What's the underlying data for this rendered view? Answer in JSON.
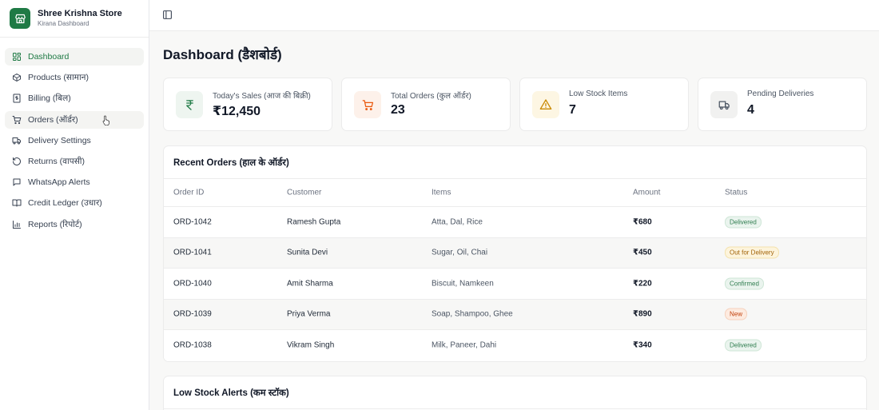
{
  "brand": {
    "name": "Shree Krishna Store",
    "subtitle": "Kirana Dashboard"
  },
  "sidebar": {
    "items": [
      {
        "label": "Dashboard",
        "icon": "grid-icon"
      },
      {
        "label": "Products (सामान)",
        "icon": "box-icon"
      },
      {
        "label": "Billing (बिल)",
        "icon": "receipt-icon"
      },
      {
        "label": "Orders (ऑर्डर)",
        "icon": "cart-icon"
      },
      {
        "label": "Delivery Settings",
        "icon": "truck-icon"
      },
      {
        "label": "Returns (वापसी)",
        "icon": "rotate-ccw-icon"
      },
      {
        "label": "WhatsApp Alerts",
        "icon": "message-icon"
      },
      {
        "label": "Credit Ledger (उधार)",
        "icon": "book-icon"
      },
      {
        "label": "Reports (रिपोर्ट)",
        "icon": "bar-chart-icon"
      }
    ]
  },
  "page": {
    "title": "Dashboard (डैशबोर्ड)"
  },
  "stats": [
    {
      "label": "Today's Sales (आज की बिक्री)",
      "value": "₹12,450",
      "icon": "rupee-icon"
    },
    {
      "label": "Total Orders (कुल ऑर्डर)",
      "value": "23",
      "icon": "cart-icon"
    },
    {
      "label": "Low Stock Items",
      "value": "7",
      "icon": "warning-icon"
    },
    {
      "label": "Pending Deliveries",
      "value": "4",
      "icon": "truck-icon"
    }
  ],
  "orders": {
    "title": "Recent Orders (हाल के ऑर्डर)",
    "columns": [
      "Order ID",
      "Customer",
      "Items",
      "Amount",
      "Status"
    ],
    "rows": [
      {
        "id": "ORD-1042",
        "customer": "Ramesh Gupta",
        "items": "Atta, Dal, Rice",
        "amount": "₹680",
        "status": "Delivered"
      },
      {
        "id": "ORD-1041",
        "customer": "Sunita Devi",
        "items": "Sugar, Oil, Chai",
        "amount": "₹450",
        "status": "Out for Delivery"
      },
      {
        "id": "ORD-1040",
        "customer": "Amit Sharma",
        "items": "Biscuit, Namkeen",
        "amount": "₹220",
        "status": "Confirmed"
      },
      {
        "id": "ORD-1039",
        "customer": "Priya Verma",
        "items": "Soap, Shampoo, Ghee",
        "amount": "₹890",
        "status": "New"
      },
      {
        "id": "ORD-1038",
        "customer": "Vikram Singh",
        "items": "Milk, Paneer, Dahi",
        "amount": "₹340",
        "status": "Delivered"
      }
    ]
  },
  "low_stock": {
    "title": "Low Stock Alerts (कम स्टॉक)"
  },
  "colors": {
    "brand": "#1f7a45",
    "delivered": "#2f7d4f",
    "out_for_delivery": "#a16207",
    "confirmed": "#2f7d4f",
    "new": "#c2410c"
  }
}
